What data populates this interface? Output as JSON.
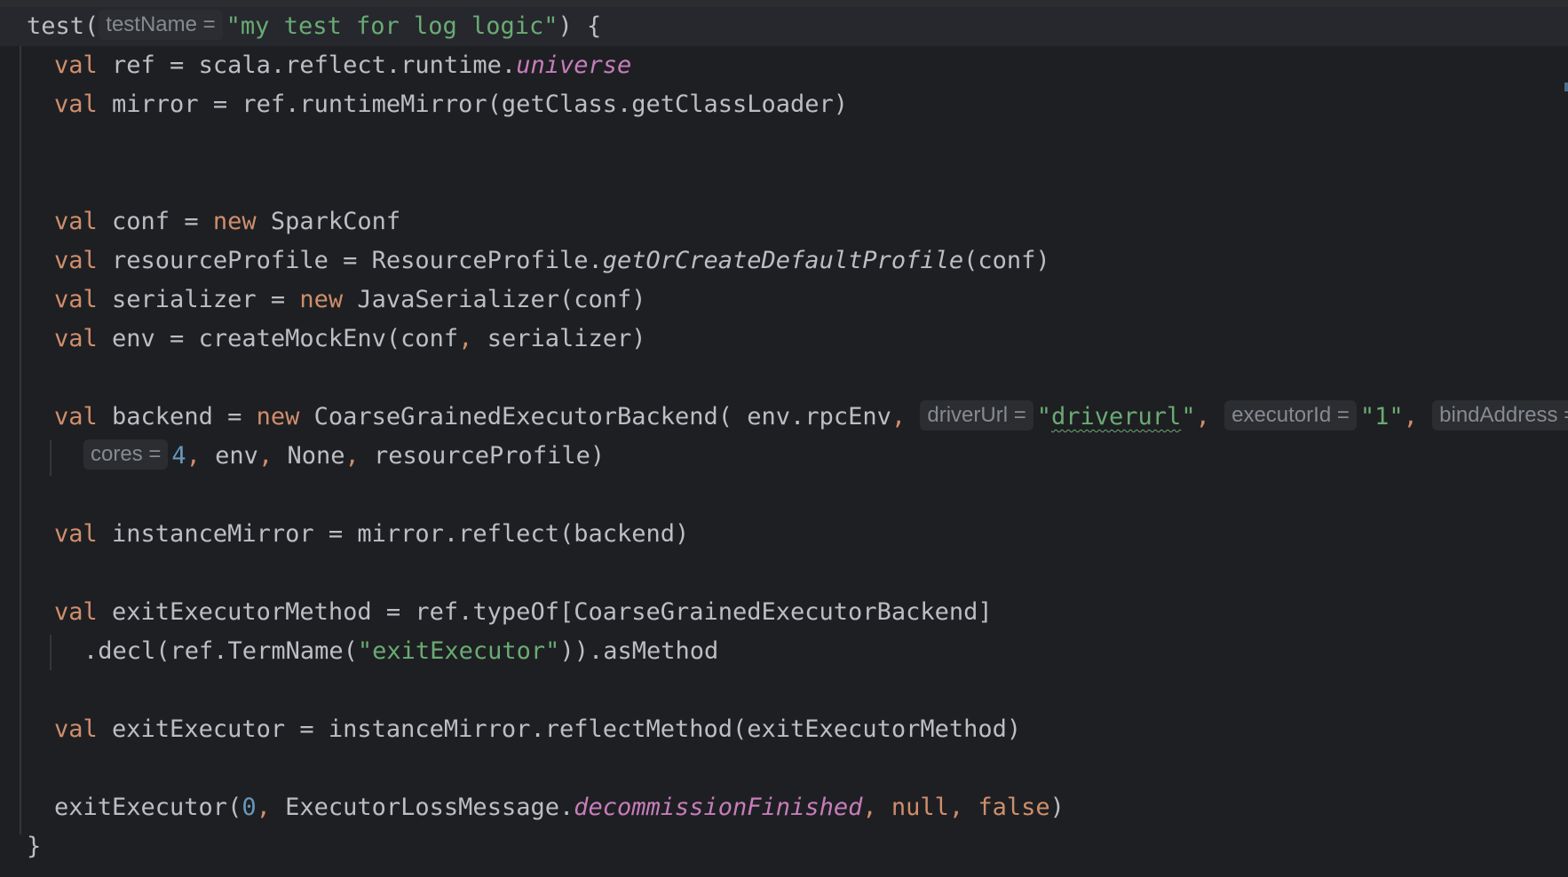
{
  "editor": {
    "language": "scala",
    "colors": {
      "background": "#1e1f22",
      "text": "#bcbec4",
      "keyword": "#cf8e6d",
      "string": "#6aab73",
      "number": "#6897bb",
      "field": "#c77dbb",
      "hint_text": "#868a91",
      "hint_background": "#2b2d30"
    },
    "lines": [
      {
        "tokens": [
          {
            "t": "plain",
            "v": "test("
          },
          {
            "t": "hint",
            "v": "testName ="
          },
          {
            "t": "str",
            "v": "\"my test for log logic\""
          },
          {
            "t": "plain",
            "v": ") {"
          }
        ]
      },
      {
        "tokens": [
          {
            "t": "kw",
            "v": "val"
          },
          {
            "t": "plain",
            "v": " ref = scala.reflect.runtime."
          },
          {
            "t": "field",
            "v": "universe"
          }
        ]
      },
      {
        "tokens": [
          {
            "t": "kw",
            "v": "val"
          },
          {
            "t": "plain",
            "v": " mirror = ref.runtimeMirror(getClass.getClassLoader)"
          }
        ]
      },
      {
        "tokens": []
      },
      {
        "tokens": []
      },
      {
        "tokens": [
          {
            "t": "kw",
            "v": "val"
          },
          {
            "t": "plain",
            "v": " conf = "
          },
          {
            "t": "kw",
            "v": "new"
          },
          {
            "t": "plain",
            "v": " SparkConf"
          }
        ]
      },
      {
        "tokens": [
          {
            "t": "kw",
            "v": "val"
          },
          {
            "t": "plain",
            "v": " resourceProfile = ResourceProfile."
          },
          {
            "t": "ital",
            "v": "getOrCreateDefaultProfile"
          },
          {
            "t": "plain",
            "v": "(conf)"
          }
        ]
      },
      {
        "tokens": [
          {
            "t": "kw",
            "v": "val"
          },
          {
            "t": "plain",
            "v": " serializer = "
          },
          {
            "t": "kw",
            "v": "new"
          },
          {
            "t": "plain",
            "v": " JavaSerializer(conf)"
          }
        ]
      },
      {
        "tokens": [
          {
            "t": "kw",
            "v": "val"
          },
          {
            "t": "plain",
            "v": " env = createMockEnv(conf"
          },
          {
            "t": "kw",
            "v": ","
          },
          {
            "t": "plain",
            "v": " serializer)"
          }
        ]
      },
      {
        "tokens": []
      },
      {
        "tokens": [
          {
            "t": "kw",
            "v": "val"
          },
          {
            "t": "plain",
            "v": " backend = "
          },
          {
            "t": "kw",
            "v": "new"
          },
          {
            "t": "plain",
            "v": " CoarseGrainedExecutorBackend( env.rpcEnv"
          },
          {
            "t": "kw",
            "v": ", "
          },
          {
            "t": "hint",
            "v": "driverUrl ="
          },
          {
            "t": "str",
            "v": "\""
          },
          {
            "t": "typo",
            "v": "driverurl"
          },
          {
            "t": "str",
            "v": "\""
          },
          {
            "t": "kw",
            "v": ", "
          },
          {
            "t": "hint",
            "v": "executorId ="
          },
          {
            "t": "str",
            "v": "\"1\""
          },
          {
            "t": "kw",
            "v": ", "
          },
          {
            "t": "hint",
            "v": "bindAddress ="
          }
        ]
      },
      {
        "tokens": [
          {
            "t": "hint",
            "v": "cores ="
          },
          {
            "t": "num",
            "v": "4"
          },
          {
            "t": "kw",
            "v": ","
          },
          {
            "t": "plain",
            "v": " env"
          },
          {
            "t": "kw",
            "v": ","
          },
          {
            "t": "plain",
            "v": " None"
          },
          {
            "t": "kw",
            "v": ","
          },
          {
            "t": "plain",
            "v": " resourceProfile)"
          }
        ]
      },
      {
        "tokens": []
      },
      {
        "tokens": [
          {
            "t": "kw",
            "v": "val"
          },
          {
            "t": "plain",
            "v": " instanceMirror = mirror.reflect(backend)"
          }
        ]
      },
      {
        "tokens": []
      },
      {
        "tokens": [
          {
            "t": "kw",
            "v": "val"
          },
          {
            "t": "plain",
            "v": " exitExecutorMethod = ref.typeOf[CoarseGrainedExecutorBackend]"
          }
        ]
      },
      {
        "tokens": [
          {
            "t": "plain",
            "v": ".decl(ref.TermName("
          },
          {
            "t": "str",
            "v": "\"exitExecutor\""
          },
          {
            "t": "plain",
            "v": ")).asMethod"
          }
        ]
      },
      {
        "tokens": []
      },
      {
        "tokens": [
          {
            "t": "kw",
            "v": "val"
          },
          {
            "t": "plain",
            "v": " exitExecutor = instanceMirror.reflectMethod(exitExecutorMethod)"
          }
        ]
      },
      {
        "tokens": []
      },
      {
        "tokens": [
          {
            "t": "plain",
            "v": "exitExecutor("
          },
          {
            "t": "num",
            "v": "0"
          },
          {
            "t": "kw",
            "v": ","
          },
          {
            "t": "plain",
            "v": " ExecutorLossMessage."
          },
          {
            "t": "field",
            "v": "decommissionFinished"
          },
          {
            "t": "kw",
            "v": ", null, false"
          },
          {
            "t": "plain",
            "v": ")"
          }
        ]
      },
      {
        "tokens": [
          {
            "t": "plain",
            "v": "}"
          }
        ]
      }
    ]
  }
}
